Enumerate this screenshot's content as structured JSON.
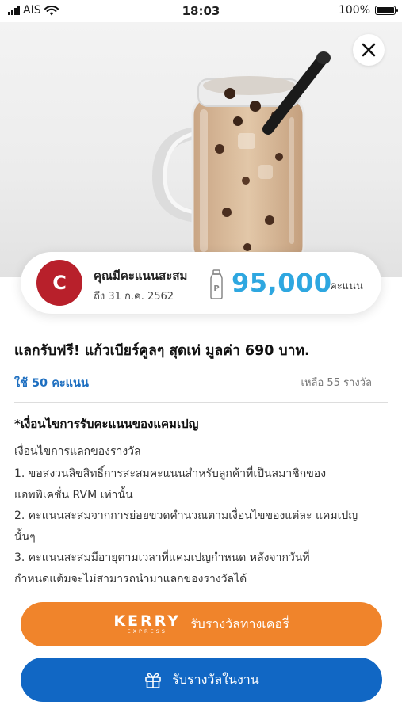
{
  "status_bar": {
    "carrier": "AIS",
    "time": "18:03",
    "battery": "100%"
  },
  "hero": {
    "image_alt": "iced milk tea with pearls in a mason jar",
    "close_icon": "close-icon"
  },
  "points": {
    "avatar_letter": "C",
    "label": "คุณมีคะแนนสะสม",
    "expiry": "ถึง 31 ก.ค. 2562",
    "value": "95,000",
    "unit": "คะแนน",
    "accent_color": "#2ea7e0",
    "avatar_color": "#b8202b"
  },
  "reward": {
    "title": "แลกรับฟรี! แก้วเบียร์คูลๆ สุดเท่ มูลค่า 690 บาท.",
    "use_points": "ใช้ 50 คะแนน",
    "remaining": "เหลือ  55 รางวัล"
  },
  "conditions": {
    "title": "*เงื่อนไขการรับคะแนนของแคมเปญ",
    "subtitle": "เงื่อนไขการแลกของรางวัล",
    "items": [
      "1. ขอสงวนลิขสิทธิ์การสะสมคะแนนสำหรับลูกค้าที่เป็นสมาชิกของ",
      "แอพพิเคชั่น RVM เท่านั้น",
      "2. คะแนนสะสมจากการย่อยขวดคำนวณตามเงื่อนไขของแต่ละ แคมเปญ",
      "นั้นๆ",
      "3. คะแนนสะสมมีอายุตามเวลาที่แคมเปญกำหนด หลังจากวันที่",
      "กำหนดแต้มจะไม่สามารถนำมาแลกของรางวัลได้"
    ]
  },
  "buttons": {
    "kerry": {
      "logo_text": "KERRY",
      "logo_sub": "EXPRESS",
      "label": "รับรางวัลทางเคอรี่",
      "color": "#f0842b"
    },
    "event": {
      "label": "รับรางวัลในงาน",
      "icon": "gift-icon",
      "color": "#1167c4"
    }
  }
}
